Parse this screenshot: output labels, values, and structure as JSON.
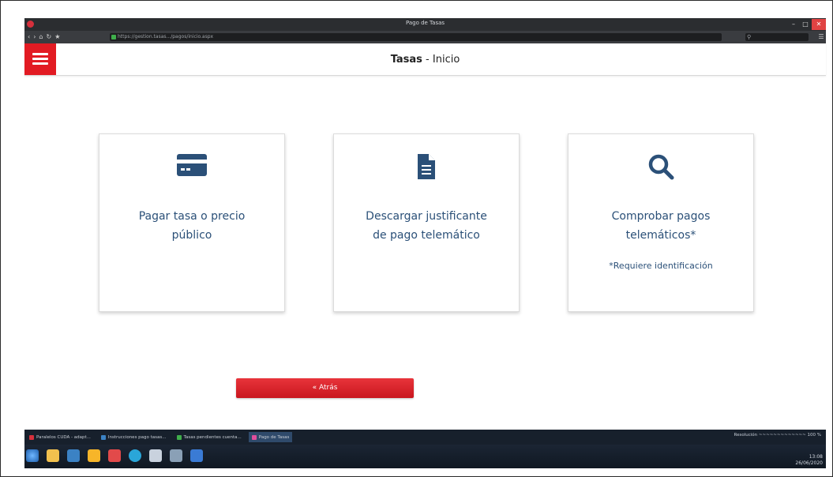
{
  "browser": {
    "window_title": "Pago de Tasas",
    "url": "https://gestion.tasas.../pagos/inicio.aspx",
    "nav_icons": [
      "‹",
      "›",
      "⌂",
      "↻",
      "★"
    ],
    "window_controls": {
      "minimize": "–",
      "maximize": "□",
      "close": "✕"
    },
    "accent": "#e21b23"
  },
  "header": {
    "title_bold": "Tasas",
    "title_rest": " - Inicio",
    "menu_icon": "hamburger-menu-icon"
  },
  "cards": [
    {
      "icon": "credit-card-icon",
      "label_line1": "Pagar tasa o precio",
      "label_line2": "público"
    },
    {
      "icon": "document-icon",
      "label_line1": "Descargar justificante",
      "label_line2": "de pago telemático"
    },
    {
      "icon": "search-icon",
      "label_line1": "Comprobar pagos",
      "label_line2": "telemáticos*",
      "note": "*Requiere identificación"
    }
  ],
  "back_button": {
    "label": "« Atrás"
  },
  "taskbar": {
    "tasks": [
      {
        "label": "Paralelos CUDA - adapt...",
        "color": "#d6303c"
      },
      {
        "label": "Instrucciones pago tasas...",
        "color": "#3b82c4"
      },
      {
        "label": "Tasas pendientes cuenta...",
        "color": "#3fae4b"
      },
      {
        "label": "Pago de Tasas",
        "color": "#e04e9c",
        "active": true
      }
    ],
    "tray_top": "Resolución ~~~~~~~~~~~~~ 100 %",
    "clock_time": "13:08",
    "clock_date": "26/06/2020"
  }
}
